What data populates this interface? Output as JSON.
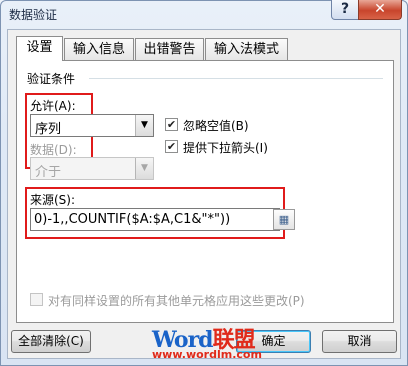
{
  "window": {
    "title": "数据验证",
    "help": "?",
    "close": "✕"
  },
  "tabs": [
    {
      "label": "设置",
      "active": true
    },
    {
      "label": "输入信息",
      "active": false
    },
    {
      "label": "出错警告",
      "active": false
    },
    {
      "label": "输入法模式",
      "active": false
    }
  ],
  "settings": {
    "group_title": "验证条件",
    "allow_label": "允许(A):",
    "allow_value": "序列",
    "data_label": "数据(D):",
    "data_value": "介于",
    "ignore_blank": {
      "label": "忽略空值(B)",
      "checked": true
    },
    "dropdown": {
      "label": "提供下拉箭头(I)",
      "checked": true
    },
    "source_label": "来源(S):",
    "source_value": "0)-1,,COUNTIF($A:$A,C1&\"*\"))",
    "apply_all": {
      "label": "对有同样设置的所有其他单元格应用这些更改(P)",
      "checked": false,
      "enabled": false
    }
  },
  "buttons": {
    "clear_all": "全部清除(C)",
    "ok": "确定",
    "cancel": "取消"
  },
  "watermark": {
    "brand_blue": "Word",
    "brand_red": "联盟",
    "url": "www.wordlm.com"
  },
  "colors": {
    "highlight": "#e01b1b",
    "title_bar": "#dfe9f6"
  }
}
